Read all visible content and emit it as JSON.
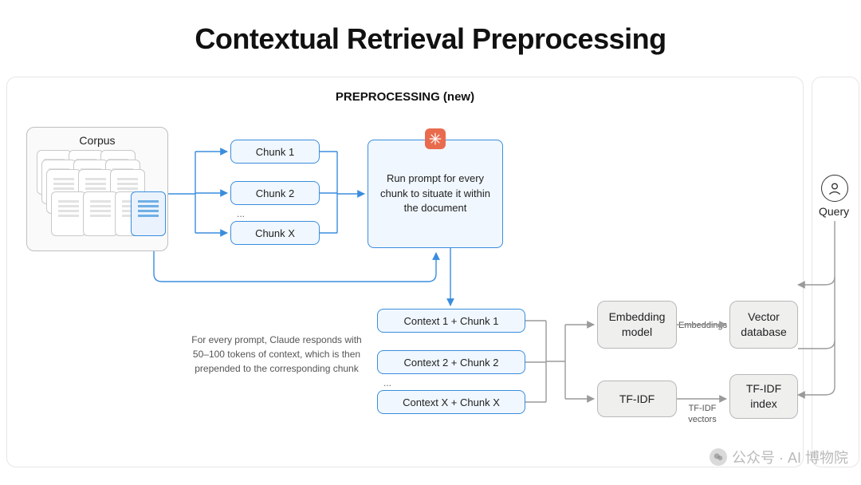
{
  "title": "Contextual Retrieval Preprocessing",
  "panel_label": "PREPROCESSING (new)",
  "corpus_label": "Corpus",
  "chunks": [
    "Chunk 1",
    "Chunk 2",
    "Chunk X"
  ],
  "chunk_ellipsis": "...",
  "prompt_box": "Run prompt for every chunk to situate it within the document",
  "caption": "For every prompt, Claude responds with 50–100 tokens of context, which is then prepended to the corresponding chunk",
  "contexts": [
    "Context 1 + Chunk 1",
    "Context 2 + Chunk 2",
    "Context X + Chunk X"
  ],
  "context_ellipsis": "...",
  "embedding_box": "Embedding model",
  "tfidf_box": "TF-IDF",
  "vector_db_box": "Vector database",
  "tfidf_index_box": "TF-IDF index",
  "edge_embeddings": "Embeddings",
  "edge_tfidf_vectors": "TF-IDF vectors",
  "query_label": "Query",
  "watermark": "公众号 · AI 博物院"
}
